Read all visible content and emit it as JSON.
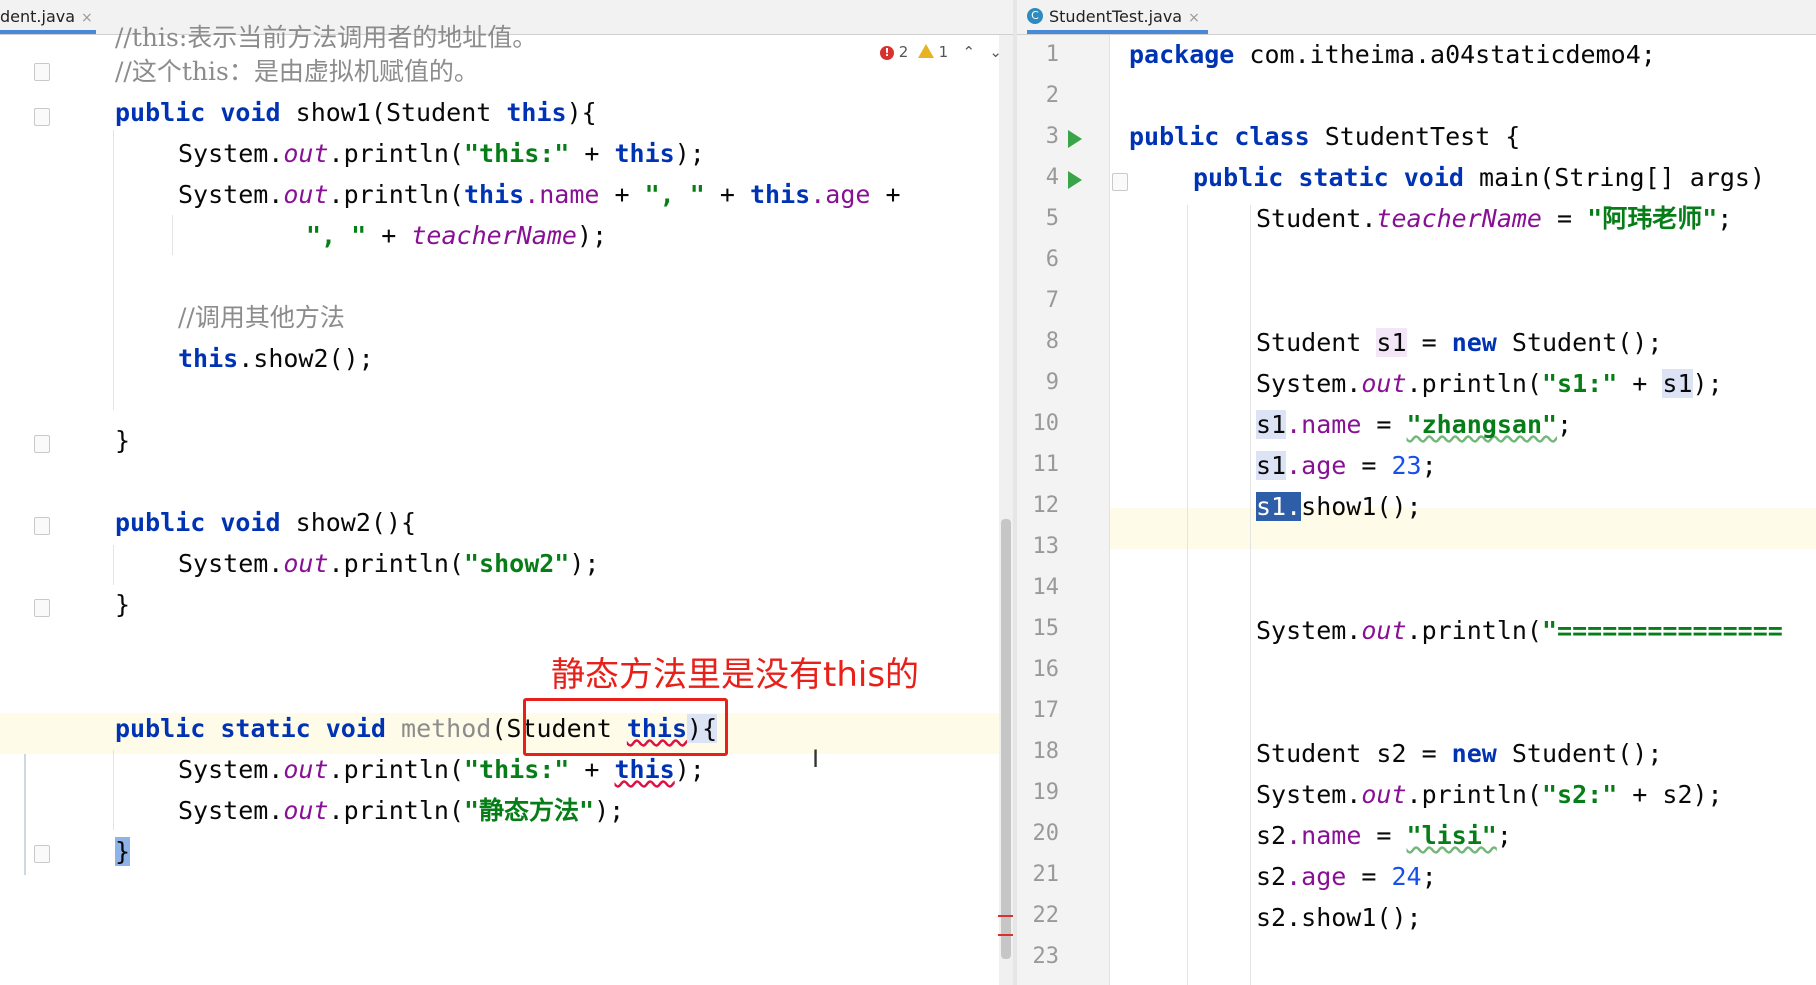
{
  "left_tab": {
    "label": "dent.java",
    "close": "×"
  },
  "right_tab": {
    "label": "StudentTest.java",
    "close": "×",
    "icon_letter": "C"
  },
  "inspection": {
    "errors": "2",
    "warnings": "1",
    "up": "⌃",
    "down": "⌄"
  },
  "left_code": {
    "l0_comment": "//this:表示当前方法调用者的地址值。",
    "l1_comment": "//这个this：是由虚拟机赋值的。",
    "l2": {
      "kw1": "public",
      "kw2": "void",
      "name": " show1(Student ",
      "kw3": "this",
      "end": "){"
    },
    "l3": {
      "pre": "System.",
      "out": "out",
      "mid": ".println(",
      "str": "\"this:\"",
      "plus": " + ",
      "kw": "this",
      "end": ");"
    },
    "l4": {
      "pre": "System.",
      "out": "out",
      "mid": ".println(",
      "kw1": "this",
      "f1": ".name",
      "plus1": " + ",
      "str": "\", \"",
      "plus2": " + ",
      "kw2": "this",
      "f2": ".age",
      "end": " +"
    },
    "l5": {
      "str": "\", \"",
      "plus": " + ",
      "field": "teacherName",
      "end": ");"
    },
    "l7_comment": "//调用其他方法",
    "l8": {
      "kw": "this",
      "rest": ".show2();"
    },
    "l10": "}",
    "l12": {
      "kw1": "public",
      "kw2": "void",
      "rest": " show2(){"
    },
    "l13": {
      "pre": "System.",
      "out": "out",
      "mid": ".println(",
      "str": "\"show2\"",
      "end": ");"
    },
    "l14": "}",
    "l17": {
      "kw1": "public",
      "kw2": "static",
      "kw3": "void",
      "method": " method",
      "paren": "(",
      "param": "Student ",
      "kw4": "this",
      "end": "){"
    },
    "l18": {
      "pre": "System.",
      "out": "out",
      "mid": ".println(",
      "str": "\"this:\"",
      "plus": " + ",
      "kw": "this",
      "end": ");"
    },
    "l19": {
      "pre": "System.",
      "out": "out",
      "mid": ".println(",
      "str": "\"静态方法\"",
      "end": ");"
    },
    "l20": "}"
  },
  "annotation": "静态方法里是没有this的",
  "right_code": {
    "line_numbers": [
      "1",
      "2",
      "3",
      "4",
      "5",
      "6",
      "7",
      "8",
      "9",
      "10",
      "11",
      "12",
      "13",
      "14",
      "15",
      "16",
      "17",
      "18",
      "19",
      "20",
      "21",
      "22",
      "23"
    ],
    "r1": {
      "kw": "package",
      "rest": " com.itheima.a04staticdemo4;"
    },
    "r3": {
      "kw1": "public",
      "kw2": "class",
      "rest": " StudentTest {"
    },
    "r4": {
      "kw1": "public",
      "kw2": "static",
      "kw3": "void",
      "rest": " main(String[] args)"
    },
    "r5": {
      "pre": "Student.",
      "field": "teacherName",
      "eq": " = ",
      "str": "\"阿玮老师\"",
      "end": ";"
    },
    "r8": {
      "pre": "Student ",
      "var": "s1",
      "eq": " = ",
      "kw": "new",
      "rest": " Student();"
    },
    "r9": {
      "pre": "System.",
      "out": "out",
      "mid": ".println(",
      "str": "\"s1:\"",
      "plus": " + ",
      "var": "s1",
      "end": ");"
    },
    "r10": {
      "var": "s1",
      "f": ".name",
      "eq": " = ",
      "str": "\"zhangsan\"",
      "end": ";"
    },
    "r11": {
      "var": "s1",
      "f": ".age",
      "eq": " = ",
      "num": "23",
      "end": ";"
    },
    "r12": {
      "sel": "s1.",
      "rest": "show1();"
    },
    "r15": {
      "pre": "System.",
      "out": "out",
      "mid": ".println(",
      "str": "\"==============="
    },
    "r18": {
      "pre": "Student s2 = ",
      "kw": "new",
      "rest": " Student();"
    },
    "r19": {
      "pre": "System.",
      "out": "out",
      "mid": ".println(",
      "str": "\"s2:\"",
      "rest": " + s2);"
    },
    "r20": {
      "pre": "s2",
      "f": ".name",
      "eq": " = ",
      "str": "\"lisi\"",
      "end": ";"
    },
    "r21": {
      "pre": "s2",
      "f": ".age",
      "eq": " = ",
      "num": "24",
      "end": ";"
    },
    "r22": {
      "rest": "s2.show1();"
    }
  },
  "colors": {
    "keyword": "#0033b3",
    "string": "#067d17",
    "comment": "#8c8c8c",
    "field": "#871094",
    "annotation": "#e8201a"
  }
}
